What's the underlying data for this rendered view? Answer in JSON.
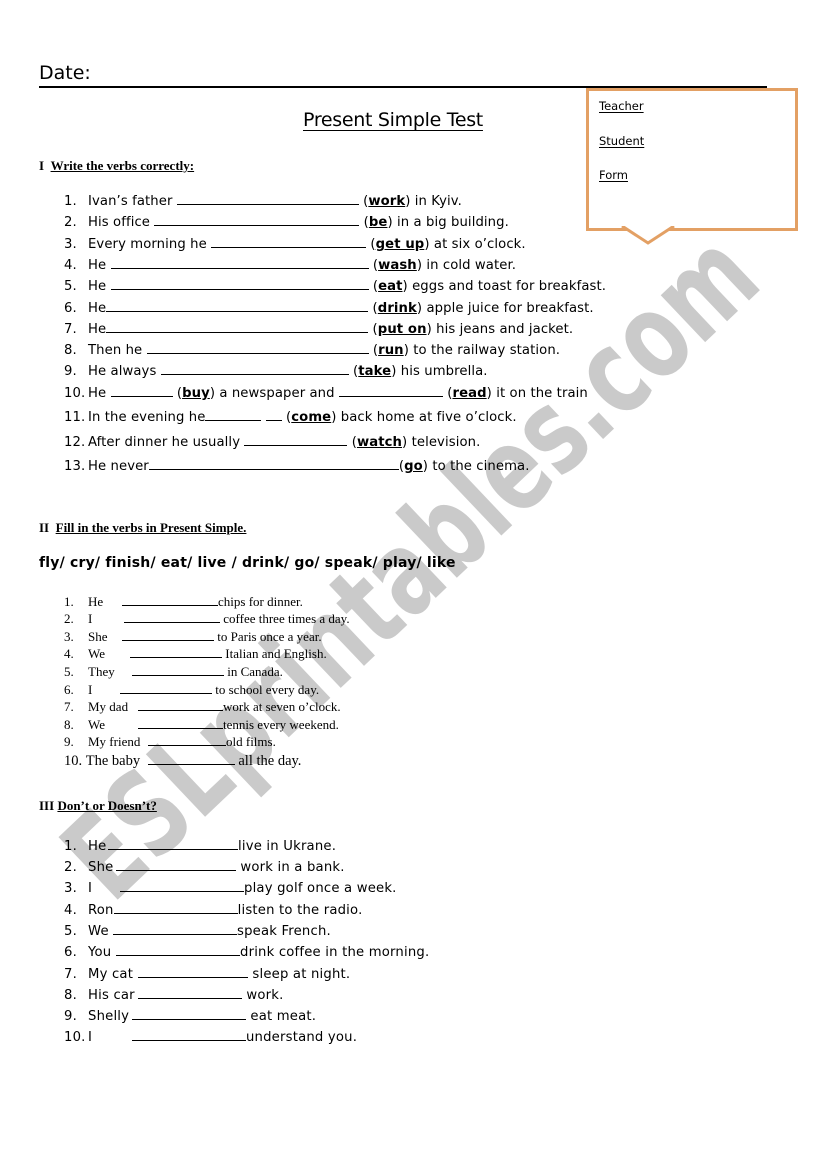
{
  "header": {
    "date_label": "Date:",
    "title": "Present Simple Test"
  },
  "callout": {
    "items": [
      "Teacher",
      "Student",
      "Form"
    ],
    "border_color": "#e3a064"
  },
  "section1": {
    "numeral": "I",
    "heading": "Write the verbs correctly:",
    "items": [
      {
        "num": "1.",
        "before": "Ivan’s father ",
        "verb": "work",
        "after": " in Kyiv."
      },
      {
        "num": "2.",
        "before": "His office ",
        "verb": "be",
        "after": " in a big building."
      },
      {
        "num": "3.",
        "before": "Every morning he ",
        "verb": "get up",
        "after": " at six o’clock."
      },
      {
        "num": "4.",
        "before": "He ",
        "verb": "wash",
        "after": " in cold water."
      },
      {
        "num": "5.",
        "before": "He ",
        "verb": "eat",
        "after": " eggs and toast for breakfast."
      },
      {
        "num": "6.",
        "before": "He",
        "verb": "drink",
        "after": " apple juice for breakfast."
      },
      {
        "num": "7.",
        "before": "He",
        "verb": "put on",
        "after": " his jeans and jacket."
      },
      {
        "num": "8.",
        "before": "Then he ",
        "verb": "run",
        "after": " to the railway station."
      },
      {
        "num": "9.",
        "before": "He always ",
        "verb": "take",
        "after": " his umbrella."
      },
      {
        "num": "10.",
        "before": "He ",
        "verb": "buy",
        "middle": " a newspaper and ",
        "verb2": "read",
        "after": " it on the train"
      },
      {
        "num": "11.",
        "before": "In the evening he",
        "verb": "come",
        "after": " back home at five o’clock."
      },
      {
        "num": "12.",
        "before": "After dinner he usually ",
        "verb": "watch",
        "after": " television."
      },
      {
        "num": "13.",
        "before": "He never",
        "verb": "go",
        "after": " to the cinema."
      }
    ]
  },
  "section2": {
    "numeral": "II",
    "heading": "Fill in the verbs in Present Simple.",
    "word_bank": "fly/ cry/ finish/ eat/ live / drink/ go/ speak/ play/ like",
    "items": [
      {
        "num": "1.",
        "subject": "He",
        "after": "chips for dinner."
      },
      {
        "num": "2.",
        "subject": "I",
        "after": " coffee three times a day."
      },
      {
        "num": "3.",
        "subject": "She",
        "after": " to Paris once a year."
      },
      {
        "num": "4.",
        "subject": "We",
        "after": " Italian and English."
      },
      {
        "num": "5.",
        "subject": "They",
        "after": " in Canada."
      },
      {
        "num": "6.",
        "subject": "I",
        "after": " to school every day."
      },
      {
        "num": "7.",
        "subject": "My dad",
        "after": "work at seven o’clock."
      },
      {
        "num": "8.",
        "subject": "We",
        "after": "tennis every weekend."
      },
      {
        "num": "9.",
        "subject": "My friend",
        "after": "old films."
      },
      {
        "num": "10.",
        "subject": "The baby",
        "after": " all the day."
      }
    ]
  },
  "section3": {
    "numeral": "III",
    "heading": "Don’t or Doesn’t?",
    "items": [
      {
        "num": "1.",
        "subject": "He",
        "after": "live in Ukrane."
      },
      {
        "num": "2.",
        "subject": "She",
        "after": " work in a bank."
      },
      {
        "num": "3.",
        "subject": "I",
        "after": "play golf once a week."
      },
      {
        "num": "4.",
        "subject": "Ron",
        "after": "listen to the radio."
      },
      {
        "num": "5.",
        "subject": "We",
        "after": "speak French."
      },
      {
        "num": "6.",
        "subject": "You",
        "after": "drink coffee in the morning."
      },
      {
        "num": "7.",
        "subject": "My cat",
        "after": " sleep at night."
      },
      {
        "num": "8.",
        "subject": "His car",
        "after": " work."
      },
      {
        "num": "9.",
        "subject": "Shelly",
        "after": " eat meat."
      },
      {
        "num": "10.",
        "subject": "I",
        "after": "understand you."
      }
    ]
  },
  "watermark": {
    "text": "ESLprintables.com",
    "color": "#b8b8b8"
  }
}
